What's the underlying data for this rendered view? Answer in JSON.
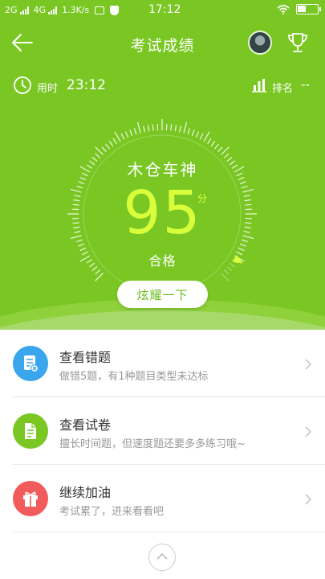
{
  "statusbar": {
    "net1": "2G",
    "net2": "4G",
    "speed": "1.3K/s",
    "time": "17:12"
  },
  "header": {
    "title": "考试成绩"
  },
  "stats": {
    "time_label": "用时",
    "time_value": "23:12",
    "rank_label": "排名",
    "rank_value": "--"
  },
  "result": {
    "nickname": "木仓车神",
    "score": "95",
    "score_unit": "分",
    "grade": "合格",
    "score_fraction": 0.95
  },
  "share_button": "炫耀一下",
  "list": [
    {
      "title": "查看错题",
      "subtitle": "做错5题，有1种题目类型未达标",
      "icon": "wrong-questions-icon",
      "color": "#39a6ee"
    },
    {
      "title": "查看试卷",
      "subtitle": "擅长时间题，但速度题还要多多练习哦~",
      "icon": "exam-paper-icon",
      "color": "#7ac723"
    },
    {
      "title": "继续加油",
      "subtitle": "考试累了，进来看看吧",
      "icon": "gift-icon",
      "color": "#f25b5b"
    }
  ],
  "colors": {
    "primary": "#7ac723",
    "score": "#d9ff3a"
  }
}
